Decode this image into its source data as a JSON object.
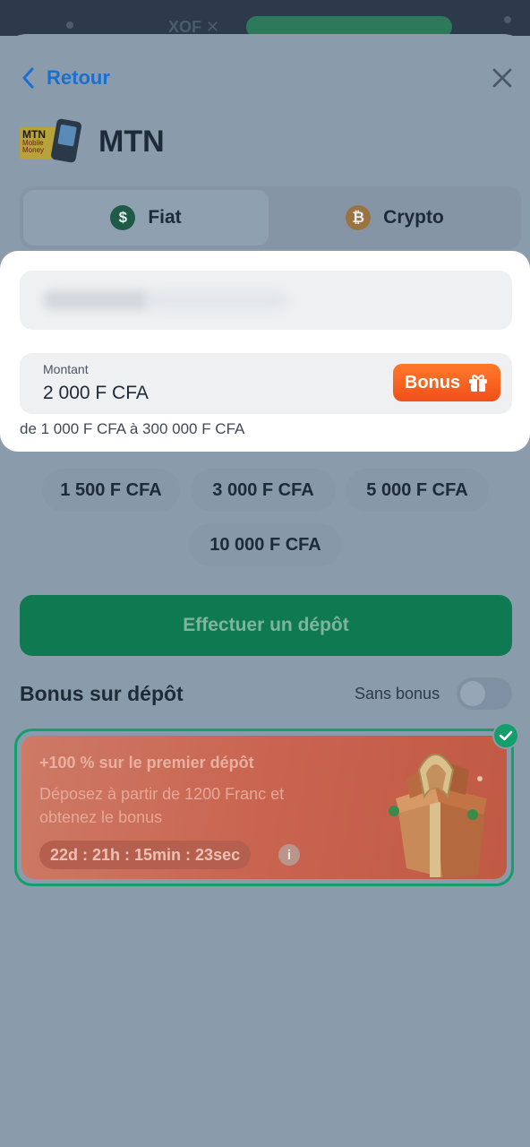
{
  "status_bar": {
    "currency_text": "XOF ✕"
  },
  "header": {
    "back_label": "Retour"
  },
  "provider": {
    "name": "MTN",
    "logo_line1": "MTN",
    "logo_line2": "Mobile Money"
  },
  "tabs": [
    {
      "label": "Fiat",
      "icon": "dollar-coin-icon",
      "glyph": "$",
      "active": true
    },
    {
      "label": "Crypto",
      "icon": "bitcoin-icon",
      "glyph": "₿",
      "active": false
    }
  ],
  "form": {
    "amount_label": "Montant",
    "amount_value": "2 000 F CFA",
    "bonus_button_label": "Bonus",
    "range_text": "de 1 000 F CFA à 300 000 F CFA"
  },
  "quick_amounts": [
    "1 500 F CFA",
    "3 000 F CFA",
    "5 000 F CFA",
    "10 000 F CFA"
  ],
  "deposit_button_label": "Effectuer un dépôt",
  "bonus_section": {
    "title": "Bonus sur dépôt",
    "toggle_label": "Sans bonus",
    "toggle_on": false
  },
  "promo": {
    "title": "+100 % sur le premier dépôt",
    "description": "Déposez à partir de 1200 Franc et obtenez le bonus",
    "timer": "22d : 21h : 15min : 23sec",
    "info_glyph": "i",
    "selected": true
  },
  "colors": {
    "accent_blue": "#1a6fd0",
    "deposit_green": "#0f7a52",
    "bonus_orange": "#f0501a",
    "selected_border": "#139e6c"
  }
}
